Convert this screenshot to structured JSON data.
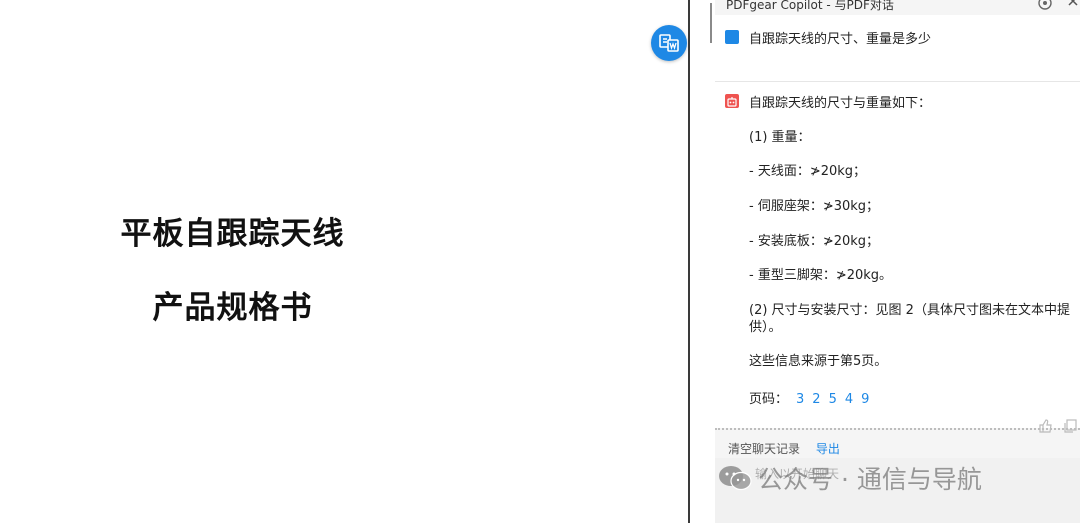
{
  "document": {
    "title_line1": "平板自跟踪天线",
    "title_line2": "产品规格书"
  },
  "panel": {
    "header_title": "PDFgear Copilot - 与PDF对话",
    "user_question": "自跟踪天线的尺寸、重量是多少",
    "answer": {
      "intro": "自跟踪天线的尺寸与重量如下：",
      "weight_heading": "(1) 重量：",
      "items": [
        "- 天线面：≯20kg；",
        "- 伺服座架：≯30kg；",
        "- 安装底板：≯20kg；",
        "- 重型三脚架：≯20kg。"
      ],
      "size_line": "(2) 尺寸与安装尺寸：见图 2（具体尺寸图未在文本中提供）。",
      "source_line": "这些信息来源于第5页。",
      "pages_label": "页码：",
      "pages": [
        "3",
        "2",
        "5",
        "4",
        "9"
      ]
    },
    "clear_label": "清空聊天记录",
    "export_label": "导出",
    "input_placeholder": "输入以开始聊天"
  },
  "watermark": {
    "text": "公众号 · 通信与导航"
  },
  "colors": {
    "accent": "#1e88e5",
    "bot_avatar": "#ef5350"
  }
}
